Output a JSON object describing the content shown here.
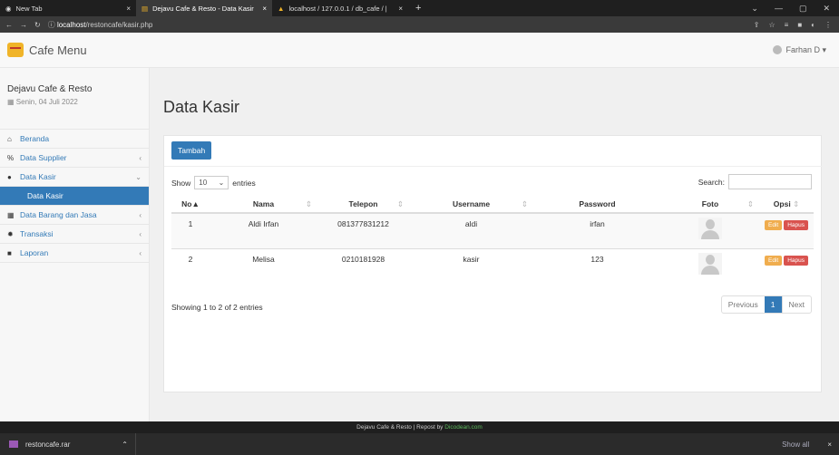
{
  "browser": {
    "tabs": [
      {
        "title": "New Tab",
        "close": "×",
        "active": false
      },
      {
        "title": "Dejavu Cafe & Resto - Data Kasir",
        "close": "×",
        "active": true
      },
      {
        "title": "localhost / 127.0.0.1 / db_cafe / |",
        "close": "×",
        "active": false
      }
    ],
    "new_tab": "+",
    "url_host": "localhost",
    "url_path": "/restoncafe/kasir.php"
  },
  "navbar": {
    "brand": "Cafe Menu",
    "user": "Farhan D ▾"
  },
  "sidebar": {
    "title": "Dejavu Cafe & Resto",
    "date": "Senin, 04 Juli 2022",
    "items": [
      {
        "label": "Beranda",
        "icon": "home-icon",
        "chevron": ""
      },
      {
        "label": "Data Supplier",
        "icon": "link-icon",
        "chevron": "‹"
      },
      {
        "label": "Data Kasir",
        "icon": "users-icon",
        "chevron": "⌄"
      },
      {
        "label": "Data Kasir",
        "icon": "",
        "chevron": ""
      },
      {
        "label": "Data Barang dan Jasa",
        "icon": "table-icon",
        "chevron": "‹"
      },
      {
        "label": "Transaksi",
        "icon": "gear-icon",
        "chevron": "‹"
      },
      {
        "label": "Laporan",
        "icon": "folder-icon",
        "chevron": "‹"
      }
    ]
  },
  "main": {
    "title": "Data Kasir",
    "add_button": "Tambah",
    "show_label": "Show",
    "entries_value": "10",
    "entries_label": "entries",
    "search_label": "Search:",
    "columns": [
      "No",
      "Nama",
      "Telepon",
      "Username",
      "Password",
      "Foto",
      "Opsi"
    ],
    "rows": [
      {
        "no": "1",
        "nama": "Aldi Irfan",
        "telepon": "081377831212",
        "username": "aldi",
        "password": "irfan"
      },
      {
        "no": "2",
        "nama": "Melisa",
        "telepon": "0210181928",
        "username": "kasir",
        "password": "123"
      }
    ],
    "edit_label": "Edit",
    "delete_label": "Hapus",
    "info": "Showing 1 to 2 of 2 entries",
    "pagination": {
      "previous": "Previous",
      "current": "1",
      "next": "Next"
    }
  },
  "footer": {
    "text": "Dejavu Cafe & Resto | Repost by ",
    "link": "Dicodean.com"
  },
  "downloads": {
    "file": "restoncafe.rar",
    "show_all": "Show all",
    "close": "×"
  }
}
